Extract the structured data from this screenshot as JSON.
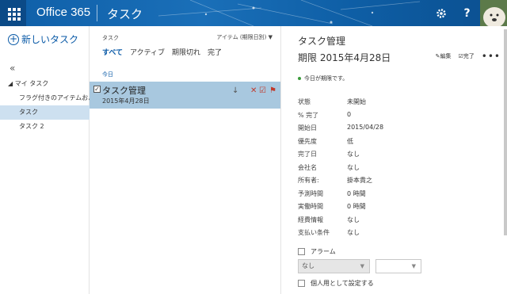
{
  "topbar": {
    "brand": "Office 365",
    "app": "タスク",
    "settings_icon": "gear-icon",
    "help_label": "?"
  },
  "left": {
    "new_task": "新しいタスク",
    "collapse": "«",
    "tree": [
      {
        "label": "◢ マイ タスク",
        "child": false,
        "selected": false
      },
      {
        "label": "フラグ付きのアイテムおよびタスク",
        "child": true,
        "selected": false
      },
      {
        "label": "タスク",
        "child": true,
        "selected": true
      },
      {
        "label": "タスク 2",
        "child": true,
        "selected": false
      }
    ]
  },
  "middle": {
    "title": "タスク",
    "sort": "アイテム (期限日別) ▼",
    "filters": {
      "all": "すべて",
      "active": "アクティブ",
      "overdue": "期限切れ",
      "done": "完了"
    },
    "group": "今日",
    "item": {
      "title": "タスク管理",
      "date": "2015年4月28日"
    }
  },
  "detail": {
    "title": "タスク管理",
    "due": "期限 2015年4月28日",
    "edit": "編集",
    "complete": "完了",
    "more": "•••",
    "notice": "今日が期限です。",
    "props": [
      {
        "k": "状態",
        "v": "未開始"
      },
      {
        "k": "% 完了",
        "v": "0"
      },
      {
        "k": "開始日",
        "v": "2015/04/28"
      },
      {
        "k": "優先度",
        "v": "低"
      },
      {
        "k": "完了日",
        "v": "なし"
      },
      {
        "k": "会社名",
        "v": "なし"
      },
      {
        "k": "所有者:",
        "v": "掛本貴之"
      },
      {
        "k": "予測時間",
        "v": "0 時間"
      },
      {
        "k": "実働時間",
        "v": "0 時間"
      },
      {
        "k": "経費情報",
        "v": "なし"
      },
      {
        "k": "支払い条件",
        "v": "なし"
      }
    ],
    "alarm": "アラーム",
    "alarm_value": "なし",
    "alarm_time": "",
    "private": "個人用として設定する"
  },
  "colors": {
    "accent": "#0a5aa7",
    "selected": "#a8c8df",
    "header": "#1a6fb8"
  }
}
